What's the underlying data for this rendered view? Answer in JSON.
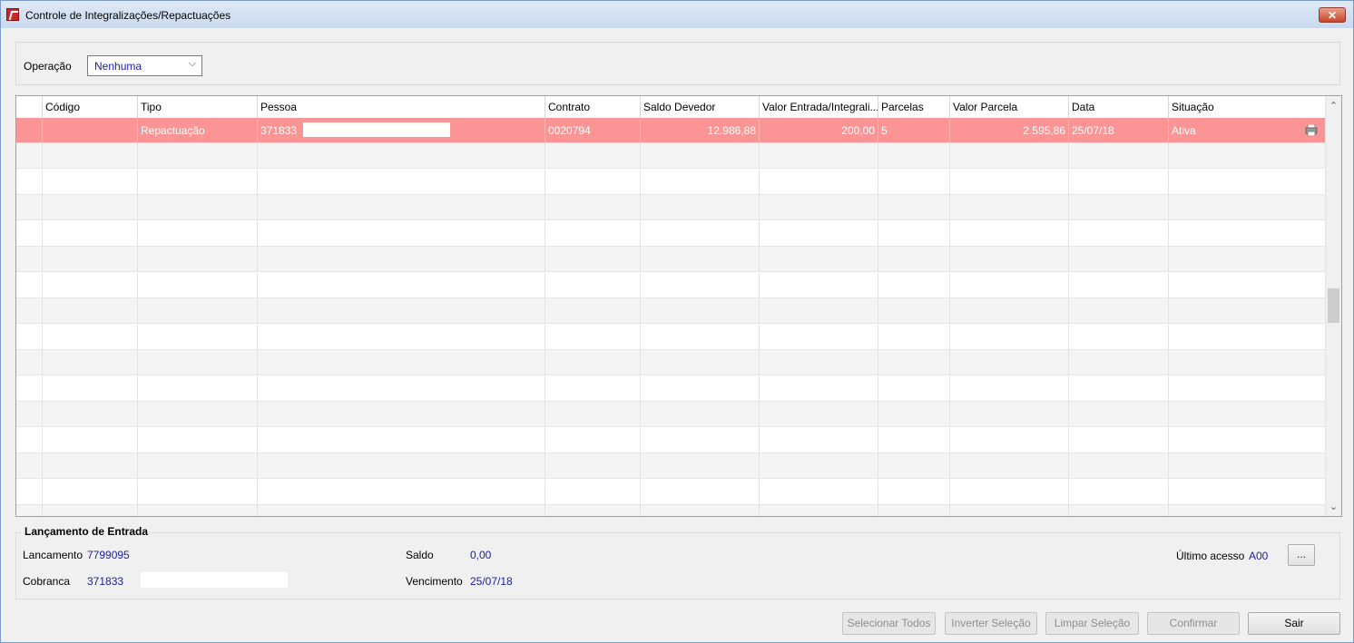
{
  "window": {
    "title": "Controle de Integralizações/Repactuações",
    "close_label": "✕"
  },
  "operation": {
    "label": "Operação",
    "selected": "Nenhuma"
  },
  "grid": {
    "columns": [
      "Código",
      "Tipo",
      "Pessoa",
      "Contrato",
      "Saldo Devedor",
      "Valor Entrada/Integrali...",
      "Parcelas",
      "Valor Parcela",
      "Data",
      "Situação"
    ],
    "rows": [
      {
        "codigo": "",
        "tipo": "Repactuação",
        "pessoa": "371833",
        "contrato": "0020794",
        "saldo_devedor": "12.986,88",
        "valor_entrada": "200,00",
        "parcelas": "5",
        "valor_parcela": "2.595,86",
        "data": "25/07/18",
        "situacao": "Ativa",
        "icon": "print-icon"
      }
    ]
  },
  "entry": {
    "title": "Lançamento de Entrada",
    "lancamento_label": "Lancamento",
    "lancamento_value": "7799095",
    "cobranca_label": "Cobranca",
    "cobranca_value": "371833",
    "saldo_label": "Saldo",
    "saldo_value": "0,00",
    "vencimento_label": "Vencimento",
    "vencimento_value": "25/07/18",
    "ultimo_label": "Último acesso",
    "ultimo_value": "A00",
    "more_label": "..."
  },
  "buttons": {
    "select_all": "Selecionar Todos",
    "invert": "Inverter Seleção",
    "clear": "Limpar Seleção",
    "confirm": "Confirmar",
    "exit": "Sair"
  },
  "colors": {
    "selected_row": "#fb9494",
    "value_text": "#1c1ca8",
    "title_gradient_top": "#dfe9f7"
  }
}
